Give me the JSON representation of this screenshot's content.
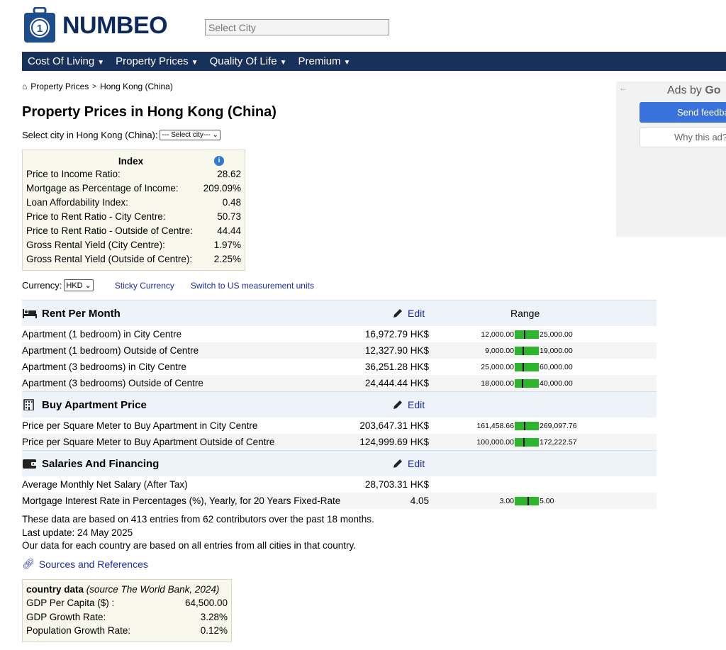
{
  "header": {
    "logo_text": "NUMBEO",
    "city_search_placeholder": "Select City"
  },
  "nav": {
    "items": [
      {
        "label": "Cost Of Living"
      },
      {
        "label": "Property Prices"
      },
      {
        "label": "Quality Of Life"
      },
      {
        "label": "Premium"
      }
    ]
  },
  "breadcrumb": {
    "items": [
      "Property Prices",
      "Hong Kong (China)"
    ],
    "separator": ">"
  },
  "page_title": "Property Prices in Hong Kong (China)",
  "city_select": {
    "label": "Select city in Hong Kong (China):",
    "value": "--- Select city---"
  },
  "index_box": {
    "title": "Index",
    "rows": [
      {
        "label": "Price to Income Ratio:",
        "value": "28.62"
      },
      {
        "label": "Mortgage as Percentage of Income:",
        "value": "209.09%"
      },
      {
        "label": "Loan Affordability Index:",
        "value": "0.48"
      },
      {
        "label": "Price to Rent Ratio - City Centre:",
        "value": "50.73"
      },
      {
        "label": "Price to Rent Ratio - Outside of Centre:",
        "value": "44.44"
      },
      {
        "label": "Gross Rental Yield (City Centre):",
        "value": "1.97%"
      },
      {
        "label": "Gross Rental Yield (Outside of Centre):",
        "value": "2.25%"
      }
    ]
  },
  "currency": {
    "label": "Currency:",
    "value": "HKD",
    "sticky_label": "Sticky Currency",
    "units_label": "Switch to US measurement units"
  },
  "table": {
    "edit_label": "Edit",
    "range_header": "Range",
    "categories": [
      {
        "title": "Rent Per Month",
        "icon": "bed-icon",
        "rows": [
          {
            "label": "Apartment (1 bedroom) in City Centre",
            "value": "16,972.79 HK$",
            "low": "12,000.00",
            "high": "25,000.00",
            "position": 0.38
          },
          {
            "label": "Apartment (1 bedroom) Outside of Centre",
            "value": "12,327.90 HK$",
            "low": "9,000.00",
            "high": "19,000.00",
            "position": 0.33
          },
          {
            "label": "Apartment (3 bedrooms) in City Centre",
            "value": "36,251.28 HK$",
            "low": "25,000.00",
            "high": "60,000.00",
            "position": 0.32
          },
          {
            "label": "Apartment (3 bedrooms) Outside of Centre",
            "value": "24,444.44 HK$",
            "low": "18,000.00",
            "high": "40,000.00",
            "position": 0.29
          }
        ]
      },
      {
        "title": "Buy Apartment Price",
        "icon": "building-icon",
        "rows": [
          {
            "label": "Price per Square Meter to Buy Apartment in City Centre",
            "value": "203,647.31 HK$",
            "low": "161,458.66",
            "high": "269,097.76",
            "position": 0.39
          },
          {
            "label": "Price per Square Meter to Buy Apartment Outside of Centre",
            "value": "124,999.69 HK$",
            "low": "100,000.00",
            "high": "172,222.57",
            "position": 0.35
          }
        ]
      },
      {
        "title": "Salaries And Financing",
        "icon": "wallet-icon",
        "rows": [
          {
            "label": "Average Monthly Net Salary (After Tax)",
            "value": "28,703.31 HK$",
            "low": "",
            "high": "",
            "position": null
          },
          {
            "label": "Mortgage Interest Rate in Percentages (%), Yearly, for 20 Years Fixed-Rate",
            "value": "4.05",
            "low": "3.00",
            "high": "5.00",
            "position": 0.52
          }
        ]
      }
    ]
  },
  "notes": {
    "line1": "These data are based on 413 entries from 62 contributors over the past 18 months.",
    "line2": "Last update: 24 May 2025",
    "line3": "Our data for each country are based on all entries from all cities in that country."
  },
  "sources_label": "Sources and References",
  "country_data": {
    "title": "country data",
    "source": "(source The World Bank, 2024)",
    "rows": [
      {
        "label": "GDP Per Capita ($) :",
        "value": "64,500.00"
      },
      {
        "label": "GDP Growth Rate:",
        "value": "3.28%"
      },
      {
        "label": "Population Growth Rate:",
        "value": "0.12%"
      }
    ]
  },
  "ads": {
    "label_prefix": "Ads by ",
    "label_brand": "Go",
    "feedback": "Send feedback",
    "why": "Why this ad?"
  },
  "colors": {
    "nav_bg": "#18315a",
    "range_bar": "#2db52d",
    "link": "#1a2aa8",
    "ads_button": "#3a72dc"
  }
}
